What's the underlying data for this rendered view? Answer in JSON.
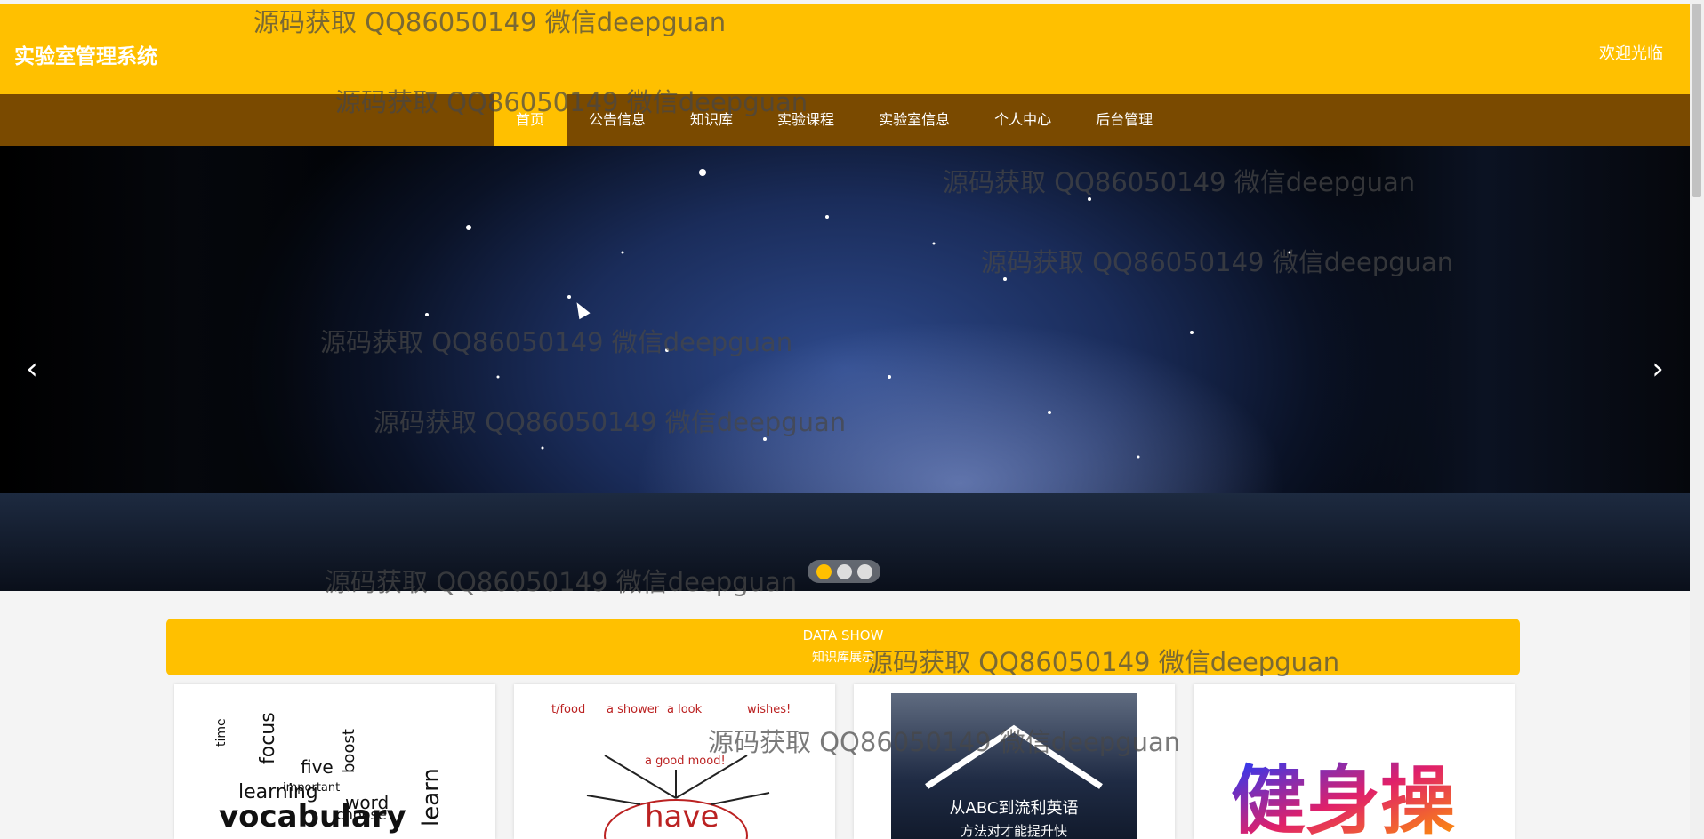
{
  "header": {
    "site_title": "实验室管理系统",
    "welcome": "欢迎光临"
  },
  "nav": {
    "items": [
      {
        "label": "首页",
        "active": true
      },
      {
        "label": "公告信息",
        "active": false
      },
      {
        "label": "知识库",
        "active": false
      },
      {
        "label": "实验课程",
        "active": false
      },
      {
        "label": "实验室信息",
        "active": false
      },
      {
        "label": "个人中心",
        "active": false
      },
      {
        "label": "后台管理",
        "active": false
      }
    ]
  },
  "carousel": {
    "prev_icon": "chevron-left-icon",
    "next_icon": "chevron-right-icon",
    "slide_count": 3,
    "active_slide": 1,
    "prev_glyph": "‹",
    "next_glyph": "›"
  },
  "section": {
    "title_en": "DATA SHOW",
    "title_zh": "知识库展示"
  },
  "cards": [
    {
      "thumb": "vocabulary-word-cloud",
      "words": [
        "vocabulary",
        "learning",
        "word",
        "focus",
        "boost",
        "time",
        "choose",
        "important",
        "five",
        "learn"
      ]
    },
    {
      "thumb": "have-mind-map",
      "words": [
        "have",
        "a shower",
        "a look",
        "wishes!",
        "a good mood!",
        "t/food"
      ]
    },
    {
      "thumb": "english-course-cover",
      "words": [
        "从ABC到流利英语",
        "方法对才能提升快"
      ]
    },
    {
      "thumb": "calligraphy-art",
      "words": [
        "健身操"
      ]
    }
  ],
  "watermark_text": "源码获取 QQ86050149 微信deepguan",
  "colors": {
    "header_bg": "#ffc000",
    "nav_bg": "#7a4a00",
    "active_nav": "#ffc000",
    "section_bar": "#ffc000"
  }
}
